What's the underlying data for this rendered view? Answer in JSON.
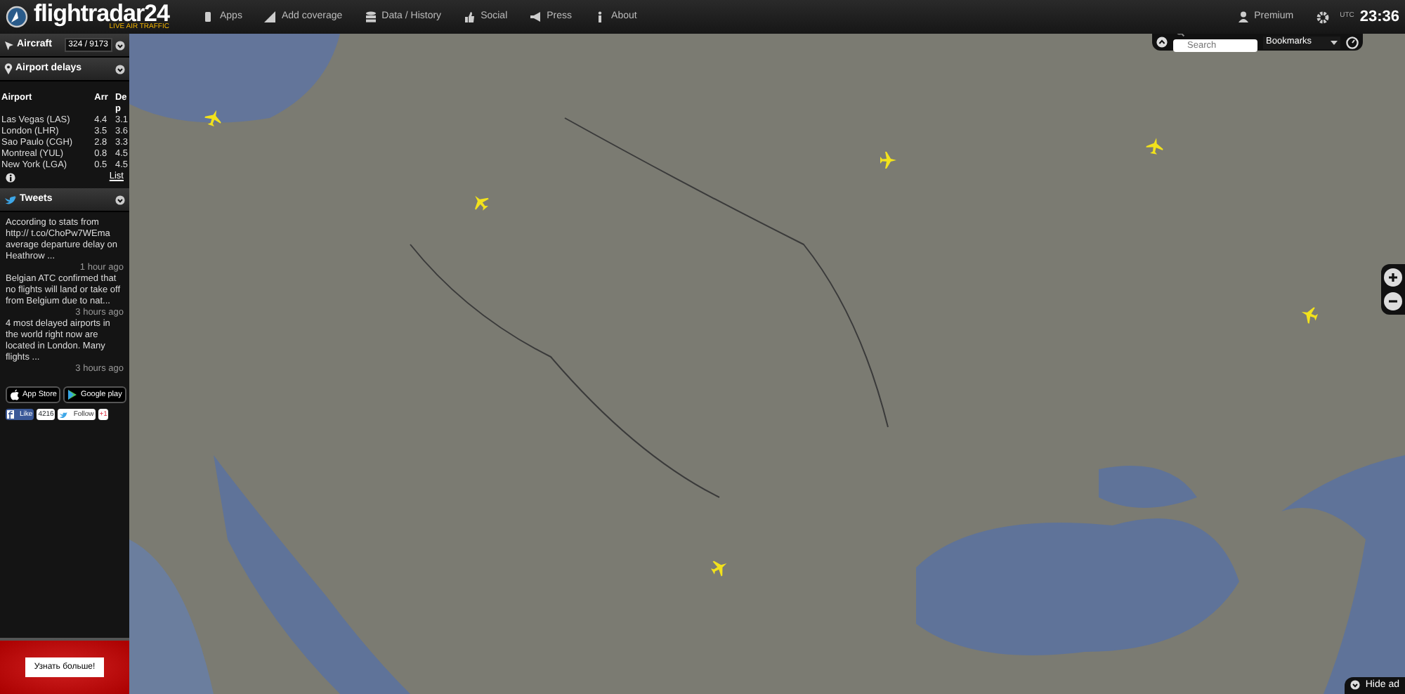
{
  "logo": {
    "name": "flightradar24",
    "tagline": "LIVE AIR TRAFFIC"
  },
  "nav": [
    {
      "label": "Apps"
    },
    {
      "label": "Add coverage"
    },
    {
      "label": "Data / History"
    },
    {
      "label": "Social"
    },
    {
      "label": "Press"
    },
    {
      "label": "About"
    }
  ],
  "user": {
    "label": "Premium"
  },
  "clock": {
    "zone": "UTC",
    "time": "23:36"
  },
  "aircraft": {
    "title": "Aircraft",
    "count": "324 / 9173"
  },
  "delays": {
    "title": "Airport delays",
    "columns": [
      "Airport",
      "Arr",
      "Dep"
    ],
    "rows": [
      [
        "Las Vegas (LAS)",
        "4.4",
        "3.1"
      ],
      [
        "London (LHR)",
        "3.5",
        "3.6"
      ],
      [
        "Sao Paulo (CGH)",
        "2.8",
        "3.3"
      ],
      [
        "Montreal (YUL)",
        "0.8",
        "4.5"
      ],
      [
        "New York (LGA)",
        "0.5",
        "4.5"
      ]
    ],
    "link": "List"
  },
  "tweets": {
    "title": "Tweets",
    "items": [
      {
        "text": "According to stats from http:// t.co/ChoPw7WEma average departure delay on Heathrow ...",
        "time": "1 hour ago"
      },
      {
        "text": "Belgian ATC confirmed that no flights will land or take off from Belgium due to nat...",
        "time": "3 hours ago"
      },
      {
        "text": "4 most delayed airports in the world right now are located in London. Many flights ...",
        "time": "3 hours ago"
      }
    ]
  },
  "stores": [
    "App Store",
    "Google play"
  ],
  "social": {
    "like": "Like",
    "like_count": "4216",
    "follow": "Follow",
    "plus": "+1"
  },
  "ad": {
    "button": "Узнать больше!"
  },
  "map": {
    "search_placeholder": "Search",
    "bookmarks": "Bookmarks",
    "hide_ad": "Hide ad"
  }
}
